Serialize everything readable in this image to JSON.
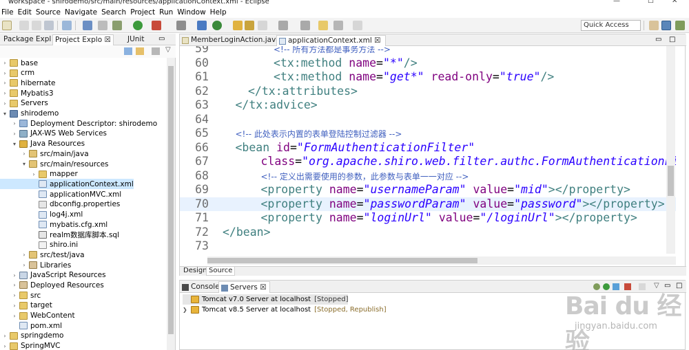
{
  "window": {
    "title": "workspace - shirodemo/src/main/resources/applicationContext.xml - Eclipse"
  },
  "menu": [
    "File",
    "Edit",
    "Source",
    "Navigate",
    "Search",
    "Project",
    "Run",
    "Window",
    "Help"
  ],
  "toolbar": {
    "quick_access": "Quick Access"
  },
  "left_panel": {
    "tabs": [
      "Package Expl",
      "Project Explo",
      "JUnit"
    ],
    "active_tab": "Project Explo",
    "tree": [
      {
        "label": "base",
        "depth": 0,
        "expanded": false,
        "icon": "folder-icon"
      },
      {
        "label": "crm",
        "depth": 0,
        "expanded": false,
        "icon": "folder-icon"
      },
      {
        "label": "hibernate",
        "depth": 0,
        "expanded": false,
        "icon": "folder-icon"
      },
      {
        "label": "Mybatis3",
        "depth": 0,
        "expanded": false,
        "icon": "folder-icon"
      },
      {
        "label": "Servers",
        "depth": 0,
        "expanded": false,
        "icon": "folder-icon"
      },
      {
        "label": "shirodemo",
        "depth": 0,
        "expanded": true,
        "icon": "project-icon"
      },
      {
        "label": "Deployment Descriptor: shirodemo",
        "depth": 1,
        "expanded": false,
        "icon": "descriptor-icon"
      },
      {
        "label": "JAX-WS Web Services",
        "depth": 1,
        "expanded": false,
        "icon": "webservice-icon"
      },
      {
        "label": "Java Resources",
        "depth": 1,
        "expanded": true,
        "icon": "java-resources-icon"
      },
      {
        "label": "src/main/java",
        "depth": 2,
        "expanded": false,
        "icon": "source-folder-icon"
      },
      {
        "label": "src/main/resources",
        "depth": 2,
        "expanded": true,
        "icon": "source-folder-icon"
      },
      {
        "label": "mapper",
        "depth": 3,
        "expanded": false,
        "icon": "folder-icon"
      },
      {
        "label": "applicationContext.xml",
        "depth": 3,
        "leaf": true,
        "icon": "xml-file-icon",
        "selected": true
      },
      {
        "label": "applicationMVC.xml",
        "depth": 3,
        "leaf": true,
        "icon": "xml-file-icon"
      },
      {
        "label": "dbconfig.properties",
        "depth": 3,
        "leaf": true,
        "icon": "properties-file-icon"
      },
      {
        "label": "log4j.xml",
        "depth": 3,
        "leaf": true,
        "icon": "xml-file-icon"
      },
      {
        "label": "mybatis.cfg.xml",
        "depth": 3,
        "leaf": true,
        "icon": "xml-file-icon"
      },
      {
        "label": "realm数据库脚本.sql",
        "depth": 3,
        "leaf": true,
        "icon": "sql-file-icon"
      },
      {
        "label": "shiro.ini",
        "depth": 3,
        "leaf": true,
        "icon": "text-file-icon"
      },
      {
        "label": "src/test/java",
        "depth": 2,
        "expanded": false,
        "icon": "source-folder-icon"
      },
      {
        "label": "Libraries",
        "depth": 2,
        "expanded": false,
        "icon": "library-icon"
      },
      {
        "label": "JavaScript Resources",
        "depth": 1,
        "expanded": false,
        "icon": "js-resources-icon"
      },
      {
        "label": "Deployed Resources",
        "depth": 1,
        "expanded": false,
        "icon": "deployed-icon"
      },
      {
        "label": "src",
        "depth": 1,
        "expanded": false,
        "icon": "folder-icon"
      },
      {
        "label": "target",
        "depth": 1,
        "expanded": false,
        "icon": "folder-icon"
      },
      {
        "label": "WebContent",
        "depth": 1,
        "expanded": false,
        "icon": "folder-icon"
      },
      {
        "label": "pom.xml",
        "depth": 1,
        "leaf": true,
        "icon": "xml-file-icon"
      },
      {
        "label": "springdemo",
        "depth": 0,
        "expanded": false,
        "icon": "folder-icon"
      },
      {
        "label": "SpringMVC",
        "depth": 0,
        "expanded": false,
        "icon": "folder-icon"
      }
    ]
  },
  "editor": {
    "tabs": [
      {
        "label": "MemberLoginAction.java",
        "active": false
      },
      {
        "label": "applicationContext.xml",
        "active": true
      }
    ],
    "lines": [
      {
        "n": "59",
        "indent": 2,
        "tokens": [
          {
            "t": "cm",
            "v": "<!-- 所有方法都是事务方法 -->"
          }
        ]
      },
      {
        "n": "60",
        "indent": 2,
        "tokens": [
          {
            "t": "tg",
            "v": "<tx:method "
          },
          {
            "t": "an",
            "v": "name"
          },
          {
            "t": "pl",
            "v": "="
          },
          {
            "t": "av",
            "v": "\"*\""
          },
          {
            "t": "tg",
            "v": "/>"
          }
        ]
      },
      {
        "n": "61",
        "indent": 2,
        "tokens": [
          {
            "t": "tg",
            "v": "<tx:method "
          },
          {
            "t": "an",
            "v": "name"
          },
          {
            "t": "pl",
            "v": "="
          },
          {
            "t": "av",
            "v": "\"get*\""
          },
          {
            "t": "pl",
            "v": " "
          },
          {
            "t": "an",
            "v": "read-only"
          },
          {
            "t": "pl",
            "v": "="
          },
          {
            "t": "av",
            "v": "\"true\""
          },
          {
            "t": "tg",
            "v": "/>"
          }
        ]
      },
      {
        "n": "62",
        "indent": 1,
        "tokens": [
          {
            "t": "tg",
            "v": "</tx:attributes>"
          }
        ]
      },
      {
        "n": "63",
        "indent": 0.5,
        "tokens": [
          {
            "t": "tg",
            "v": "</tx:advice>"
          }
        ]
      },
      {
        "n": "64",
        "indent": 0,
        "tokens": []
      },
      {
        "n": "65",
        "indent": 0.5,
        "tokens": [
          {
            "t": "cm",
            "v": "<!-- 此处表示内置的表单登陆控制过滤器 -->"
          }
        ]
      },
      {
        "n": "66",
        "indent": 0.5,
        "tokens": [
          {
            "t": "tg",
            "v": "<bean "
          },
          {
            "t": "an",
            "v": "id"
          },
          {
            "t": "pl",
            "v": "="
          },
          {
            "t": "av",
            "v": "\"FormAuthenticationFilter\""
          }
        ]
      },
      {
        "n": "67",
        "indent": 1.5,
        "tokens": [
          {
            "t": "an",
            "v": "class"
          },
          {
            "t": "pl",
            "v": "="
          },
          {
            "t": "av",
            "v": "\"org.apache.shiro.web.filter.authc.FormAuthenticationFilt"
          }
        ]
      },
      {
        "n": "68",
        "indent": 1.5,
        "tokens": [
          {
            "t": "cm",
            "v": "<!-- 定义出需要使用的参数，此参数与表单一一对应 -->"
          }
        ]
      },
      {
        "n": "69",
        "indent": 1.5,
        "tokens": [
          {
            "t": "tg",
            "v": "<property "
          },
          {
            "t": "an",
            "v": "name"
          },
          {
            "t": "pl",
            "v": "="
          },
          {
            "t": "av",
            "v": "\"usernameParam\""
          },
          {
            "t": "pl",
            "v": " "
          },
          {
            "t": "an",
            "v": "value"
          },
          {
            "t": "pl",
            "v": "="
          },
          {
            "t": "av",
            "v": "\"mid\""
          },
          {
            "t": "tg",
            "v": "></property>"
          }
        ]
      },
      {
        "n": "70",
        "indent": 1.5,
        "current": true,
        "tokens": [
          {
            "t": "tg",
            "v": "<property "
          },
          {
            "t": "an",
            "v": "name"
          },
          {
            "t": "pl",
            "v": "="
          },
          {
            "t": "av",
            "v": "\"passwordParam\""
          },
          {
            "t": "pl",
            "v": " "
          },
          {
            "t": "an",
            "v": "value"
          },
          {
            "t": "pl",
            "v": "="
          },
          {
            "t": "av",
            "v": "\"password\""
          },
          {
            "t": "tg",
            "v": "></property>"
          }
        ]
      },
      {
        "n": "71",
        "indent": 1.5,
        "tokens": [
          {
            "t": "tg",
            "v": "<property "
          },
          {
            "t": "an",
            "v": "name"
          },
          {
            "t": "pl",
            "v": "="
          },
          {
            "t": "av",
            "v": "\"loginUrl\""
          },
          {
            "t": "pl",
            "v": " "
          },
          {
            "t": "an",
            "v": "value"
          },
          {
            "t": "pl",
            "v": "="
          },
          {
            "t": "av",
            "v": "\"/loginUrl\""
          },
          {
            "t": "tg",
            "v": "></property>"
          }
        ]
      },
      {
        "n": "72",
        "indent": 0,
        "tokens": [
          {
            "t": "tg",
            "v": "</bean>"
          }
        ]
      },
      {
        "n": "73",
        "indent": 0,
        "tokens": []
      }
    ],
    "bottom_tabs": [
      "Design",
      "Source"
    ],
    "active_bottom_tab": "Source"
  },
  "bottom_panel": {
    "tabs": [
      "Console",
      "Servers"
    ],
    "active_tab": "Servers",
    "servers": [
      {
        "name": "Tomcat v7.0 Server at localhost",
        "status": "[Stopped]",
        "selected": true,
        "expandable": false
      },
      {
        "name": "Tomcat v8.5 Server at localhost",
        "status": "[Stopped, Republish]",
        "selected": false,
        "expandable": true
      }
    ]
  },
  "watermark": {
    "logo": "Bai du 经验",
    "url": "jingyan.baidu.com"
  },
  "colors": {
    "tag": "#3f7f7f",
    "attr_name": "#7f007f",
    "attr_value": "#2a00ff",
    "comment": "#3f5fbf",
    "selection": "#cde8ff",
    "current_line": "#e8f2fe"
  }
}
